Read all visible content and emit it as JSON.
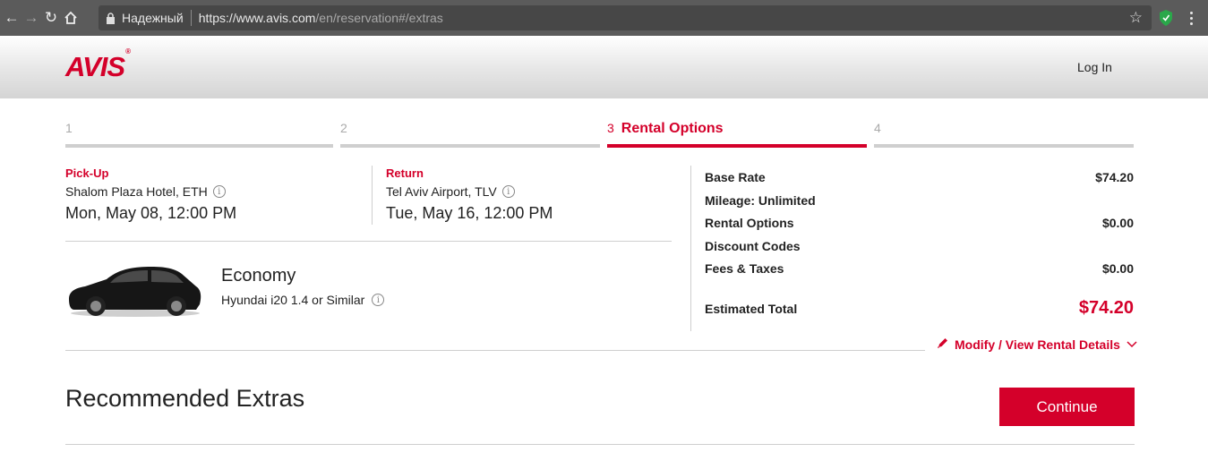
{
  "browser": {
    "secure_label": "Надежный",
    "url_host": "https://www.avis.com",
    "url_path": "/en/reservation#/extras"
  },
  "header": {
    "logo": "AVIS",
    "logo_mark": "®",
    "login": "Log In"
  },
  "steps": [
    {
      "num": "1",
      "label": ""
    },
    {
      "num": "2",
      "label": ""
    },
    {
      "num": "3",
      "label": "Rental Options"
    },
    {
      "num": "4",
      "label": ""
    }
  ],
  "pickup": {
    "label": "Pick-Up",
    "location": "Shalom Plaza Hotel, ETH",
    "datetime": "Mon, May 08, 12:00 PM"
  },
  "return": {
    "label": "Return",
    "location": "Tel Aviv Airport, TLV",
    "datetime": "Tue, May 16, 12:00 PM"
  },
  "car": {
    "class": "Economy",
    "model": "Hyundai i20 1.4 or Similar"
  },
  "summary": {
    "rows": [
      {
        "label": "Base Rate",
        "amount": "$74.20"
      },
      {
        "label": "Mileage: Unlimited",
        "amount": ""
      },
      {
        "label": "Rental Options",
        "amount": "$0.00"
      },
      {
        "label": "Discount Codes",
        "amount": ""
      },
      {
        "label": "Fees & Taxes",
        "amount": "$0.00"
      }
    ],
    "total_label": "Estimated Total",
    "total_amount": "$74.20",
    "modify_link": "Modify / View Rental Details"
  },
  "extras": {
    "title": "Recommended Extras",
    "continue_label": "Continue"
  },
  "colors": {
    "brand_red": "#d4002a"
  }
}
